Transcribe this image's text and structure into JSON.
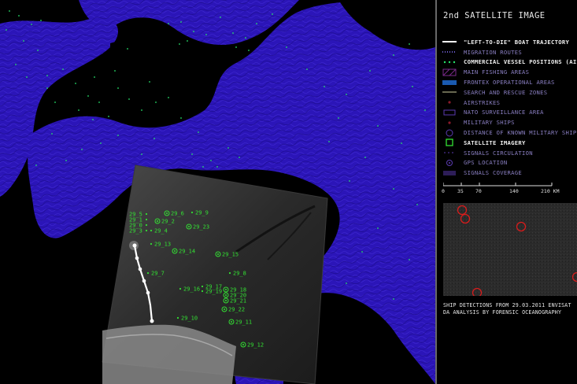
{
  "panel": {
    "title": "2nd SATELLITE IMAGE",
    "legend": [
      {
        "label": "\"LEFT-TO-DIE\" BOAT TRAJECTORY",
        "swatch": "line-white",
        "active": true
      },
      {
        "label": "MIGRATION ROUTES",
        "swatch": "dots-purple",
        "active": false
      },
      {
        "label": "COMMERCIAL VESSEL POSITIONS (AIS D",
        "swatch": "dots-green",
        "active": true
      },
      {
        "label": "MAIN FISHING AREAS",
        "swatch": "hatch-purple",
        "active": false
      },
      {
        "label": "FRONTEX OPERATIONAL AREAS",
        "swatch": "fill-blue",
        "active": false
      },
      {
        "label": "SEARCH AND RESCUE ZONES",
        "swatch": "line-grey",
        "active": false
      },
      {
        "label": "AIRSTRIKES",
        "swatch": "dot-red",
        "active": false
      },
      {
        "label": "NATO SURVEILLANCE AREA",
        "swatch": "outline-purple",
        "active": false
      },
      {
        "label": "MILITARY SHIPS",
        "swatch": "dot-red",
        "active": false
      },
      {
        "label": "DISTANCE OF KNOWN MILITARY SHIPS",
        "swatch": "circle-purple",
        "active": false
      },
      {
        "label": "SATELLITE IMAGERY",
        "swatch": "square-green",
        "active": true
      },
      {
        "label": "SIGNALS CIRCULATION",
        "swatch": "dash-purple",
        "active": false
      },
      {
        "label": "GPS LOCATION",
        "swatch": "ring-purple",
        "active": false
      },
      {
        "label": "SIGNALS COVERAGE",
        "swatch": "lines-purple",
        "active": false
      }
    ],
    "scale": {
      "ticks": [
        "0",
        "35",
        "70",
        "140",
        "210 KM"
      ],
      "km": [
        0,
        35,
        70,
        140,
        210
      ]
    },
    "inset_caption": "SHIP DETECTIONS FROM 29.03.2011 ENVISAT DA ANALYSIS BY FORENSIC OCEANOGRAPHY"
  },
  "colors": {
    "sea": "#2b15b8",
    "land": "#000000",
    "vessel_dot": "#27e36a",
    "detection": "#33e033",
    "trajectory": "#ffffff",
    "inset_circle": "#d81c1c"
  },
  "detections": [
    {
      "id": "29_5"
    },
    {
      "id": "29_6"
    },
    {
      "id": "29_9"
    },
    {
      "id": "29_1"
    },
    {
      "id": "29_2"
    },
    {
      "id": "29_0"
    },
    {
      "id": "29_3"
    },
    {
      "id": "29_4"
    },
    {
      "id": "29_23"
    },
    {
      "id": "29_13"
    },
    {
      "id": "29_14"
    },
    {
      "id": "29_15"
    },
    {
      "id": "29_7"
    },
    {
      "id": "29_8"
    },
    {
      "id": "29_16"
    },
    {
      "id": "29_17"
    },
    {
      "id": "29_19"
    },
    {
      "id": "29_18"
    },
    {
      "id": "29_20"
    },
    {
      "id": "29_21"
    },
    {
      "id": "29_22"
    },
    {
      "id": "29_10"
    },
    {
      "id": "29_11"
    },
    {
      "id": "29_12"
    }
  ]
}
